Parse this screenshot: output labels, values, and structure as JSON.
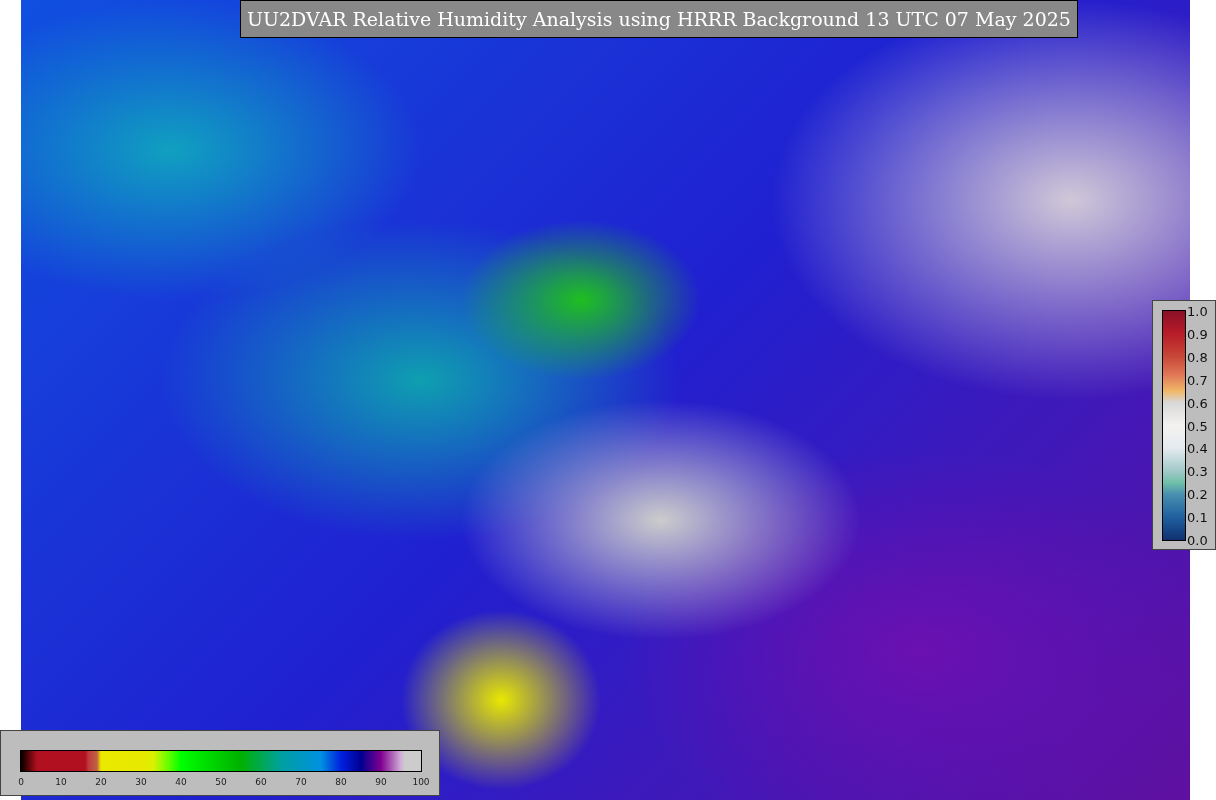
{
  "title": "UU2DVAR Relative Humidity Analysis using HRRR Background 13 UTC 07 May 2025",
  "observation_colorbar": {
    "ticks": [
      "1.0",
      "0.9",
      "0.8",
      "0.7",
      "0.6",
      "0.5",
      "0.4",
      "0.3",
      "0.2",
      "0.1",
      "0.0"
    ]
  },
  "humidity_colorbar": {
    "ticks": [
      "0",
      "10",
      "20",
      "30",
      "40",
      "50",
      "60",
      "70",
      "80",
      "90",
      "100"
    ]
  }
}
